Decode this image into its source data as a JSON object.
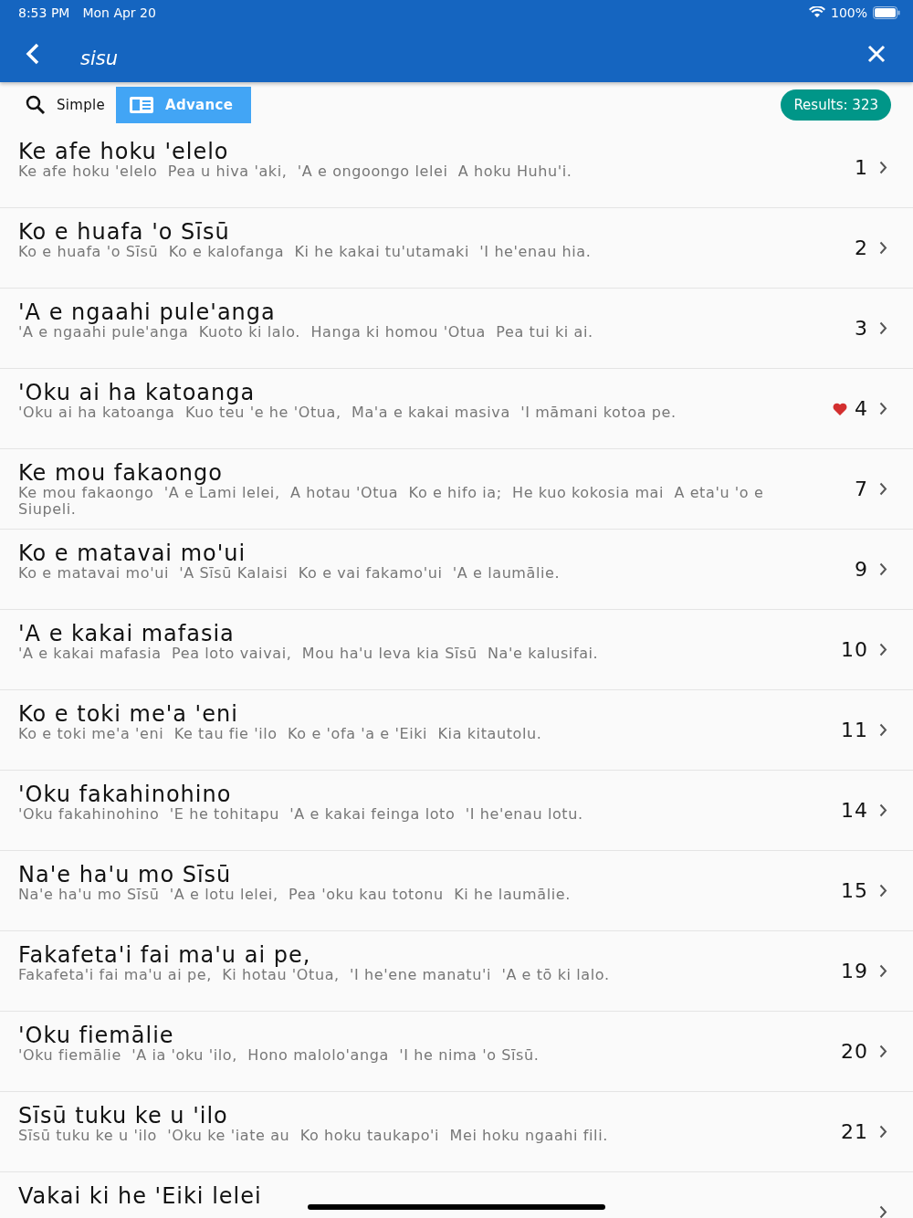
{
  "status_bar": {
    "time": "8:53 PM",
    "date": "Mon Apr 20",
    "battery": "100%"
  },
  "app_bar": {
    "query": "sisu"
  },
  "mode_tabs": [
    {
      "label": "Simple",
      "selected": false,
      "kind": "search"
    },
    {
      "label": "Advance",
      "selected": true,
      "kind": "book"
    }
  ],
  "results_badge": "Results: 323",
  "results": [
    {
      "title": "Ke afe hoku 'elelo",
      "preview": "Ke afe hoku 'elelo  Pea u hiva 'aki,  'A e ongoongo lelei  A hoku Huhu'i.",
      "number": "1",
      "favorite": false
    },
    {
      "title": "Ko e huafa 'o Sīsū",
      "preview": "Ko e huafa 'o Sīsū  Ko e kalofanga  Ki he kakai tu'utamaki  'I he'enau hia.",
      "number": "2",
      "favorite": false
    },
    {
      "title": "'A e ngaahi pule'anga",
      "preview": "'A e ngaahi pule'anga  Kuoto ki lalo.  Hanga ki homou 'Otua  Pea tui ki ai.",
      "number": "3",
      "favorite": false
    },
    {
      "title": "'Oku ai ha katoanga",
      "preview": "'Oku ai ha katoanga  Kuo teu 'e he 'Otua,  Ma'a e kakai masiva  'I māmani kotoa pe.",
      "number": "4",
      "favorite": true
    },
    {
      "title": "Ke mou fakaongo",
      "preview": "Ke mou fakaongo  'A e Lami lelei,  A hotau 'Otua  Ko e hifo ia;  He kuo kokosia mai  A eta'u 'o e Siupeli.",
      "number": "7",
      "favorite": false
    },
    {
      "title": "Ko e matavai mo'ui",
      "preview": "Ko e matavai mo'ui  'A Sīsū Kalaisi  Ko e vai fakamo'ui  'A e laumālie.",
      "number": "9",
      "favorite": false
    },
    {
      "title": "'A e kakai mafasia",
      "preview": "'A e kakai mafasia  Pea loto vaivai,  Mou ha'u leva kia Sīsū  Na'e kalusifai.",
      "number": "10",
      "favorite": false
    },
    {
      "title": "Ko e toki me'a 'eni",
      "preview": "Ko e toki me'a 'eni  Ke tau fie 'ilo  Ko e 'ofa 'a e 'Eiki  Kia kitautolu.",
      "number": "11",
      "favorite": false
    },
    {
      "title": "'Oku fakahinohino",
      "preview": "'Oku fakahinohino  'E he tohitapu  'A e kakai feinga loto  'I he'enau lotu.",
      "number": "14",
      "favorite": false
    },
    {
      "title": "Na'e ha'u mo Sīsū",
      "preview": "Na'e ha'u mo Sīsū  'A e lotu lelei,  Pea 'oku kau totonu  Ki he laumālie.",
      "number": "15",
      "favorite": false
    },
    {
      "title": "Fakafeta'i fai ma'u ai pe,",
      "preview": "Fakafeta'i fai ma'u ai pe,  Ki hotau 'Otua,  'I he'ene manatu'i  'A e tō ki lalo.",
      "number": "19",
      "favorite": false
    },
    {
      "title": "'Oku fiemālie",
      "preview": "'Oku fiemālie  'A ia 'oku 'ilo,  Hono malolo'anga  'I he nima 'o Sīsū.",
      "number": "20",
      "favorite": false
    },
    {
      "title": "Sīsū tuku ke u 'ilo",
      "preview": "Sīsū tuku ke u 'ilo  'Oku ke 'iate au  Ko hoku taukapo'i  Mei hoku ngaahi fili.",
      "number": "21",
      "favorite": false
    },
    {
      "title": "Vakai ki he 'Eiki lelei",
      "favorite": false
    }
  ]
}
